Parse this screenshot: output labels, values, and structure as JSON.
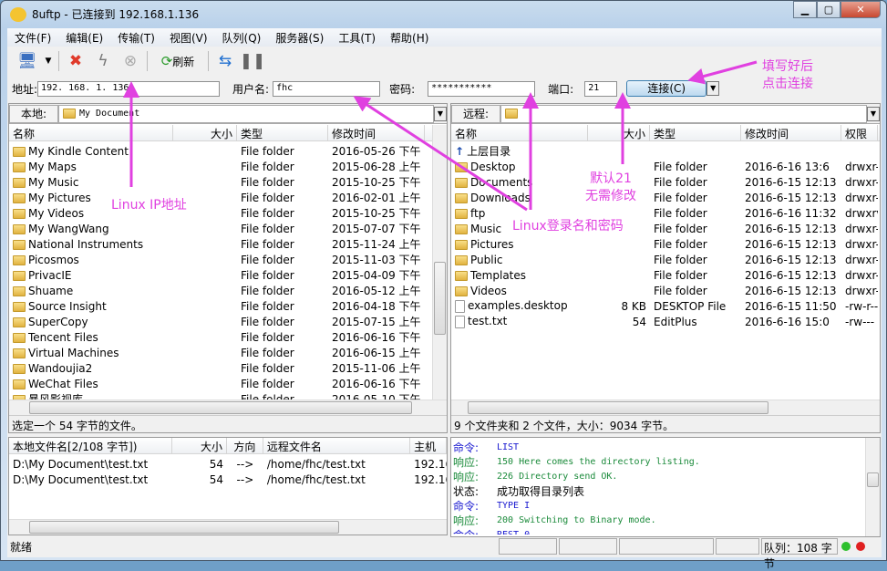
{
  "window": {
    "title": "8uftp - 已连接到 192.168.1.136"
  },
  "menu": [
    "文件(F)",
    "编辑(E)",
    "传输(T)",
    "视图(V)",
    "队列(Q)",
    "服务器(S)",
    "工具(T)",
    "帮助(H)"
  ],
  "toolbar": {
    "refresh_label": "刷新"
  },
  "connect": {
    "address_label": "地址:",
    "address": "192. 168. 1. 136",
    "user_label": "用户名:",
    "user": "fhc",
    "password_label": "密码:",
    "password": "***********",
    "port_label": "端口:",
    "port": "21",
    "connect_label": "连接(C)"
  },
  "local": {
    "label": "本地:",
    "path": "My Document",
    "columns": [
      "名称",
      "大小",
      "类型",
      "修改时间"
    ],
    "rows": [
      [
        "My Kindle Content",
        "",
        "File folder",
        "2016-05-26 下午 ..."
      ],
      [
        "My Maps",
        "",
        "File folder",
        "2015-06-28 上午 ..."
      ],
      [
        "My Music",
        "",
        "File folder",
        "2015-10-25 下午 ..."
      ],
      [
        "My Pictures",
        "",
        "File folder",
        "2016-02-01 上午 ..."
      ],
      [
        "My Videos",
        "",
        "File folder",
        "2015-10-25 下午 ..."
      ],
      [
        "My WangWang",
        "",
        "File folder",
        "2015-07-07 下午 ..."
      ],
      [
        "National Instruments",
        "",
        "File folder",
        "2015-11-24 上午 ..."
      ],
      [
        "Picosmos",
        "",
        "File folder",
        "2015-11-03 下午 ..."
      ],
      [
        "PrivacIE",
        "",
        "File folder",
        "2015-04-09 下午 ..."
      ],
      [
        "Shuame",
        "",
        "File folder",
        "2016-05-12 上午 ..."
      ],
      [
        "Source Insight",
        "",
        "File folder",
        "2016-04-18 下午 ..."
      ],
      [
        "SuperCopy",
        "",
        "File folder",
        "2015-07-15 上午 ..."
      ],
      [
        "Tencent Files",
        "",
        "File folder",
        "2016-06-16 下午 ..."
      ],
      [
        "Virtual Machines",
        "",
        "File folder",
        "2016-06-15 上午 ..."
      ],
      [
        "Wandoujia2",
        "",
        "File folder",
        "2015-11-06 上午 ..."
      ],
      [
        "WeChat Files",
        "",
        "File folder",
        "2016-06-16 下午 ..."
      ],
      [
        "暴风影视库",
        "",
        "File folder",
        "2016-05-10 下午"
      ]
    ],
    "status": "选定一个 54 字节的文件。"
  },
  "remote": {
    "label": "远程:",
    "path": "",
    "columns": [
      "名称",
      "大小",
      "类型",
      "修改时间",
      "权限"
    ],
    "parent": "上层目录",
    "rows": [
      [
        "Desktop",
        "",
        "File folder",
        "2016-6-16 13:6",
        "drwxr-"
      ],
      [
        "Documents",
        "",
        "File folder",
        "2016-6-15 12:13",
        "drwxr-"
      ],
      [
        "Downloads",
        "",
        "File folder",
        "2016-6-15 12:13",
        "drwxr-"
      ],
      [
        "ftp",
        "",
        "File folder",
        "2016-6-16 11:32",
        "drwxrv"
      ],
      [
        "Music",
        "",
        "File folder",
        "2016-6-15 12:13",
        "drwxr-"
      ],
      [
        "Pictures",
        "",
        "File folder",
        "2016-6-15 12:13",
        "drwxr-"
      ],
      [
        "Public",
        "",
        "File folder",
        "2016-6-15 12:13",
        "drwxr-"
      ],
      [
        "Templates",
        "",
        "File folder",
        "2016-6-15 12:13",
        "drwxr-"
      ],
      [
        "Videos",
        "",
        "File folder",
        "2016-6-15 12:13",
        "drwxr-"
      ],
      [
        "examples.desktop",
        "8 KB",
        "DESKTOP File",
        "2016-6-15 11:50",
        "-rw-r--"
      ],
      [
        "test.txt",
        "54",
        "EditPlus",
        "2016-6-16 15:0",
        "-rw---"
      ]
    ],
    "status": "9 个文件夹和 2 个文件，大小：9034 字节。"
  },
  "queue": {
    "columns": [
      "本地文件名[2/108 字节])",
      "大小",
      "方向",
      "远程文件名",
      "主机"
    ],
    "rows": [
      [
        "D:\\My Document\\test.txt",
        "54",
        "-->",
        "/home/fhc/test.txt",
        "192.16"
      ],
      [
        "D:\\My Document\\test.txt",
        "54",
        "-->",
        "/home/fhc/test.txt",
        "192.16"
      ]
    ]
  },
  "log": [
    {
      "k": "命令:",
      "v": "LIST",
      "c": "#1a1ad0"
    },
    {
      "k": "响应:",
      "v": "150 Here comes the directory listing.",
      "c": "#1a8a3a"
    },
    {
      "k": "响应:",
      "v": "226 Directory send OK.",
      "c": "#1a8a3a"
    },
    {
      "k": "状态:",
      "v": "成功取得目录列表",
      "c": "#000000"
    },
    {
      "k": "命令:",
      "v": "TYPE I",
      "c": "#1a1ad0"
    },
    {
      "k": "响应:",
      "v": "200 Switching to Binary mode.",
      "c": "#1a8a3a"
    },
    {
      "k": "命令:",
      "v": "REST 0",
      "c": "#1a1ad0"
    }
  ],
  "statusbar": {
    "ready": "就绪",
    "queue": "队列：108 字节"
  },
  "annotations": {
    "ip": "Linux IP地址",
    "login": "Linux登录名和密码",
    "port1": "默认21",
    "port2": "无需修改",
    "connect1": "填写好后",
    "connect2": "点击连接",
    "color": "#e040e0"
  }
}
